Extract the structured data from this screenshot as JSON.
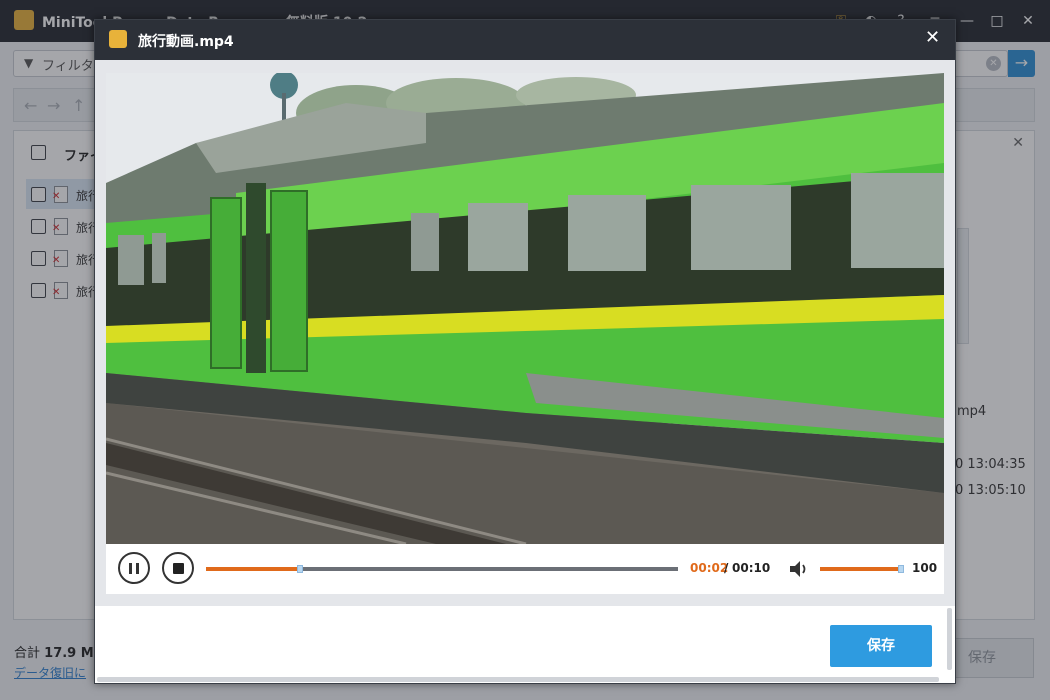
{
  "background": {
    "app_title": "MiniTool Power Data Recovery 無料版 10.2",
    "search_placeholder": "フィルタ",
    "column_header": "ファイ",
    "file_rows": [
      "旅行",
      "旅行",
      "旅行",
      "旅行"
    ],
    "info_lines": [
      "mp4",
      "0 13:04:35",
      "0 13:05:10"
    ],
    "total_label": "合計",
    "total_value": "17.9 M",
    "footer_link": "データ復旧に",
    "save_label": "保存"
  },
  "modal": {
    "title": "旅行動画.mp4",
    "close_glyph": "✕",
    "icon": "file-video-icon"
  },
  "player": {
    "current_time": "00:02",
    "separator": "/",
    "total_time": "00:10",
    "progress_fraction": 0.2,
    "volume_level": 100,
    "volume_label": "100",
    "accent_color": "#e06a1b"
  },
  "save_button": {
    "label": "保存",
    "color": "#2e9be0"
  }
}
